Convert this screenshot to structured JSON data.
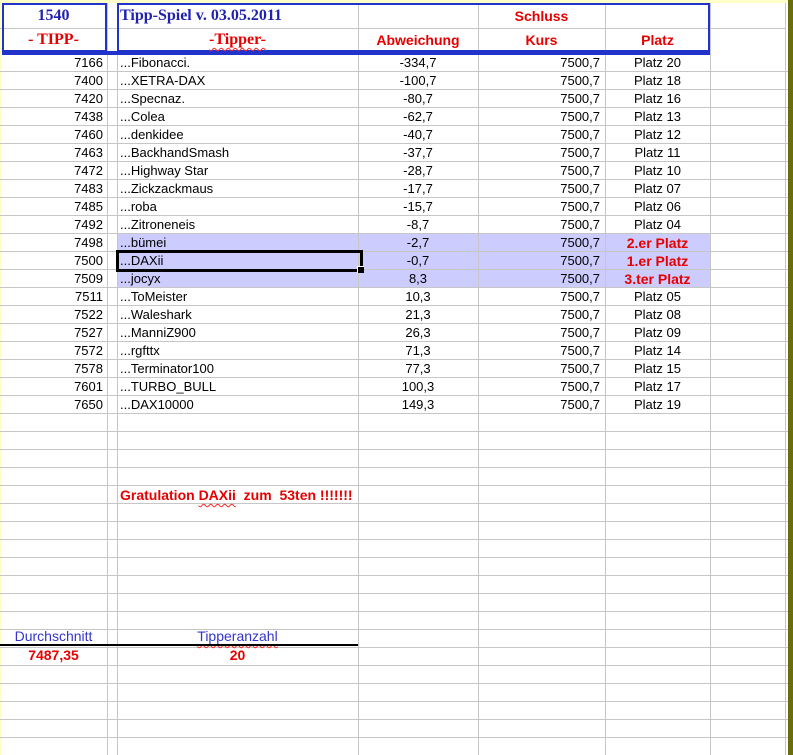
{
  "header": {
    "tipp_number": "1540",
    "title": "Tipp-Spiel v. 03.05.2011",
    "schluss": "Schluss",
    "columns": {
      "tipp": "- TIPP-",
      "tipper": "-Tipper-",
      "abweichung": "Abweichung",
      "kurs": "Kurs",
      "platz": "Platz"
    }
  },
  "rows": [
    {
      "tipp": "7166",
      "tipper": "...Fibonacci.",
      "abweichung": "-334,7",
      "kurs": "7500,7",
      "platz": "Platz 20"
    },
    {
      "tipp": "7400",
      "tipper": "...XETRA-DAX",
      "abweichung": "-100,7",
      "kurs": "7500,7",
      "platz": "Platz 18"
    },
    {
      "tipp": "7420",
      "tipper": "...Specnaz.",
      "abweichung": "-80,7",
      "kurs": "7500,7",
      "platz": "Platz 16"
    },
    {
      "tipp": "7438",
      "tipper": "...Colea",
      "abweichung": "-62,7",
      "kurs": "7500,7",
      "platz": "Platz 13"
    },
    {
      "tipp": "7460",
      "tipper": "...denkidee",
      "abweichung": "-40,7",
      "kurs": "7500,7",
      "platz": "Platz 12"
    },
    {
      "tipp": "7463",
      "tipper": "...BackhandSmash",
      "abweichung": "-37,7",
      "kurs": "7500,7",
      "platz": "Platz 11"
    },
    {
      "tipp": "7472",
      "tipper": "...Highway Star",
      "abweichung": "-28,7",
      "kurs": "7500,7",
      "platz": "Platz 10"
    },
    {
      "tipp": "7483",
      "tipper": "...Zickzackmaus",
      "abweichung": "-17,7",
      "kurs": "7500,7",
      "platz": "Platz 07"
    },
    {
      "tipp": "7485",
      "tipper": "...roba",
      "abweichung": "-15,7",
      "kurs": "7500,7",
      "platz": "Platz 06"
    },
    {
      "tipp": "7492",
      "tipper": "...Zitroneneis",
      "abweichung": "-8,7",
      "kurs": "7500,7",
      "platz": "Platz 04"
    },
    {
      "tipp": "7498",
      "tipper": "...bümei",
      "abweichung": "-2,7",
      "kurs": "7500,7",
      "platz": "2.er Platz",
      "highlighted": true,
      "platz_red": true
    },
    {
      "tipp": "7500",
      "tipper": "...DAXii",
      "abweichung": "-0,7",
      "kurs": "7500,7",
      "platz": "1.er Platz",
      "highlighted": true,
      "platz_red": true,
      "selected": true
    },
    {
      "tipp": "7509",
      "tipper": "...jocyx",
      "abweichung": "8,3",
      "kurs": "7500,7",
      "platz": "3.ter Platz",
      "highlighted": true,
      "platz_red": true
    },
    {
      "tipp": "7511",
      "tipper": "...ToMeister",
      "abweichung": "10,3",
      "kurs": "7500,7",
      "platz": "Platz 05"
    },
    {
      "tipp": "7522",
      "tipper": "...Waleshark",
      "abweichung": "21,3",
      "kurs": "7500,7",
      "platz": "Platz 08"
    },
    {
      "tipp": "7527",
      "tipper": "...ManniZ900",
      "abweichung": "26,3",
      "kurs": "7500,7",
      "platz": "Platz 09"
    },
    {
      "tipp": "7572",
      "tipper": "...rgfttx",
      "abweichung": "71,3",
      "kurs": "7500,7",
      "platz": "Platz 14"
    },
    {
      "tipp": "7578",
      "tipper": "...Terminator100",
      "abweichung": "77,3",
      "kurs": "7500,7",
      "platz": "Platz 15"
    },
    {
      "tipp": "7601",
      "tipper": "...TURBO_BULL",
      "abweichung": "100,3",
      "kurs": "7500,7",
      "platz": "Platz 17"
    },
    {
      "tipp": "7650",
      "tipper": "...DAX10000",
      "abweichung": "149,3",
      "kurs": "7500,7",
      "platz": "Platz 19"
    }
  ],
  "message": {
    "prefix": "Gratulation ",
    "name": "DAXii",
    "suffix": "  zum  53ten !!!!!!!"
  },
  "summary": {
    "durchschnitt_label": "Durchschnitt",
    "durchschnitt_value": "7487,35",
    "tipperanzahl_label": "Tipperanzahl",
    "tipperanzahl_value": "20"
  },
  "colors": {
    "title_blue": "#2121b0",
    "accent_red": "#e60000",
    "highlight_lavender": "#ccccff",
    "border_blue": "#2233cc",
    "gridline_gray": "#c6c6c6",
    "summary_blue": "#3434cc",
    "window_edge_olive": "#6b6b10",
    "window_margin_yellow": "#ffffc8"
  }
}
